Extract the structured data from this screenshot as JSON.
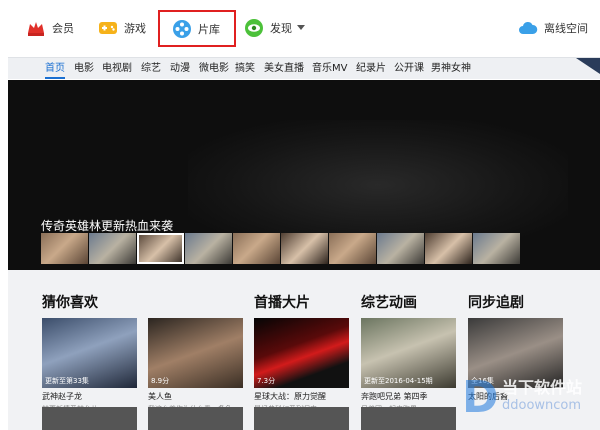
{
  "topnav": {
    "member": "会员",
    "games": "游戏",
    "library": "片库",
    "discover": "发现",
    "offline": "离线空间"
  },
  "categories": [
    "首页",
    "电影",
    "电视剧",
    "综艺",
    "动漫",
    "微电影",
    "搞笑",
    "美女直播",
    "音乐MV",
    "纪录片",
    "公开课",
    "男神女神"
  ],
  "banner": {
    "title": "传奇英雄林更新热血来袭"
  },
  "sections": {
    "guess": "猜你喜欢",
    "premiere": "首播大片",
    "variety": "综艺动画",
    "sync": "同步追剧"
  },
  "cards": [
    {
      "badge": "更新至第33集",
      "title": "武神赵子龙",
      "sub": "林更新情系林允儿"
    },
    {
      "badge": "8.9分",
      "title": "美人鱼",
      "sub": "我这么美你为什么看一条鱼"
    },
    {
      "badge": "7.3分",
      "title": "星球大战：原力觉醒",
      "sub": "最经典科幻系列归来"
    },
    {
      "badge": "更新至2016-04-15期",
      "title": "奔跑吧兄弟 第四季",
      "sub": "兄弟团一起来跑男"
    },
    {
      "badge": "全16集",
      "title": "太阳的后裔",
      "sub": ""
    }
  ],
  "watermark": {
    "text": "当下软件站",
    "url": "ddoowncom"
  },
  "colors": {
    "accent": "#1a6fd1",
    "highlight_box": "#e02020",
    "banner_bg": "#0e0e0e"
  }
}
